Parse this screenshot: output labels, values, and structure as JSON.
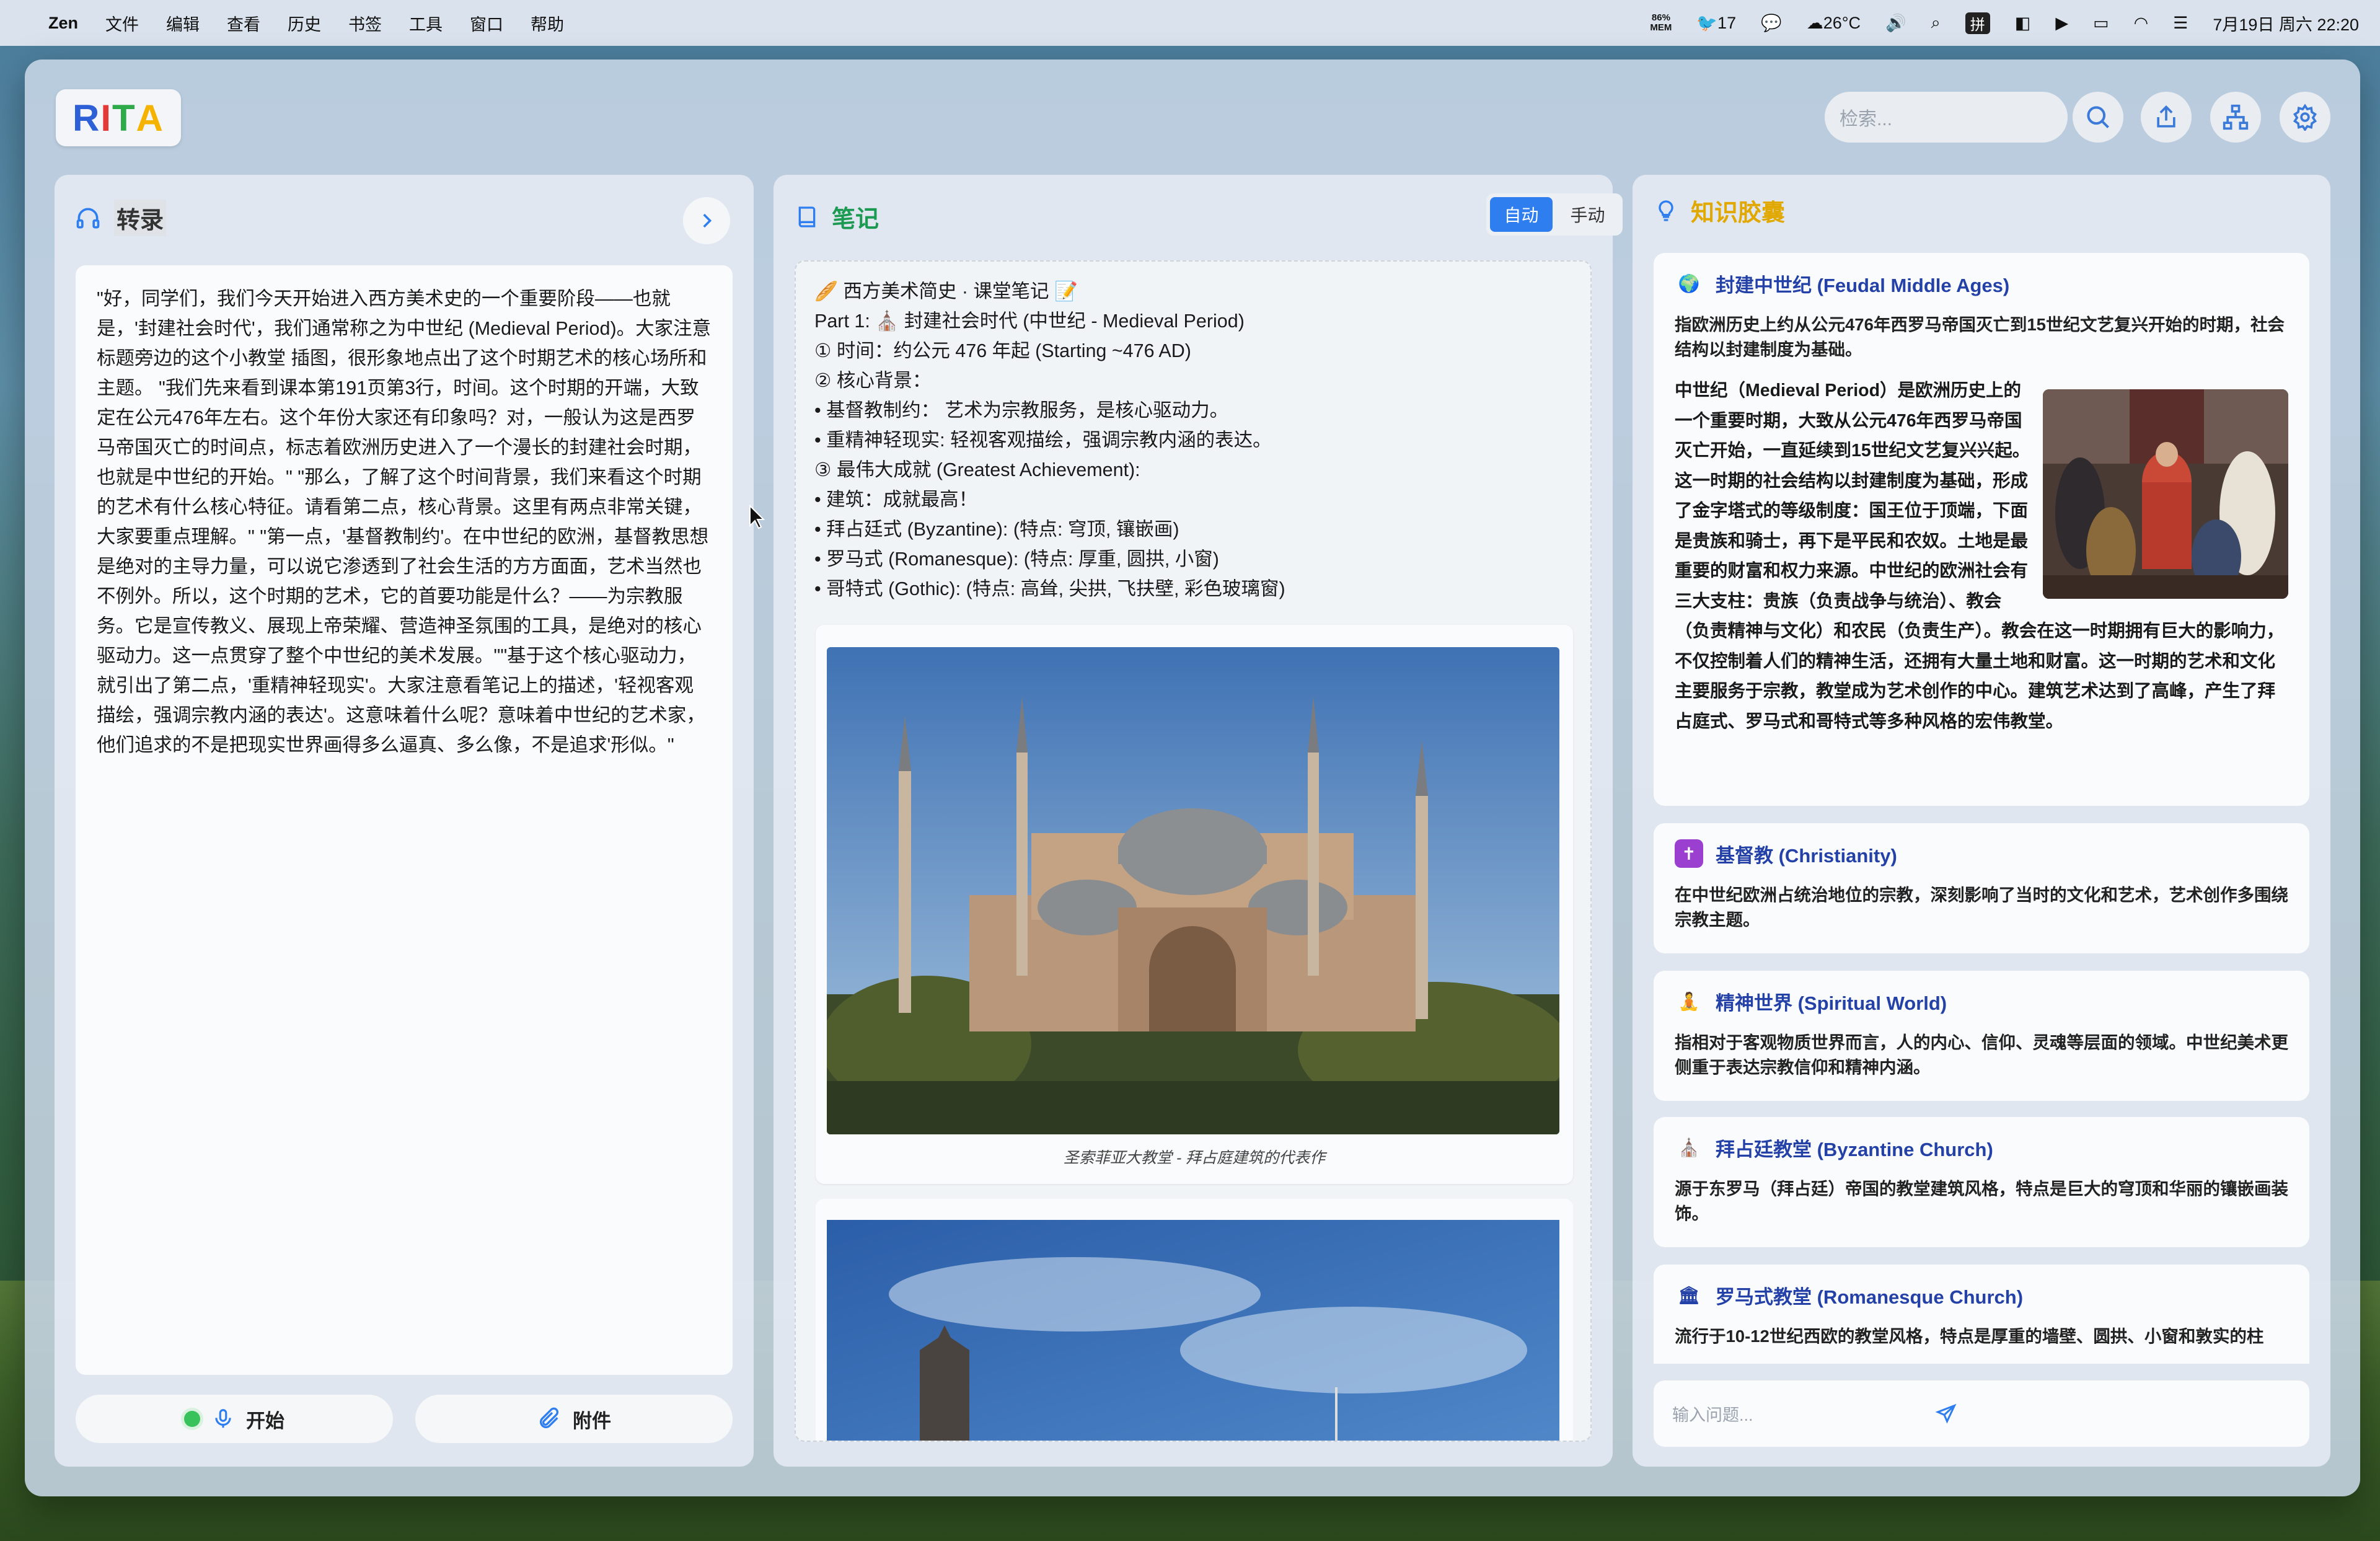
{
  "menubar": {
    "app": "Zen",
    "items": [
      "文件",
      "编辑",
      "查看",
      "历史",
      "书签",
      "工具",
      "窗口",
      "帮助"
    ],
    "mem_pct": "86%",
    "mem_label": "MEM",
    "notif_count": "17",
    "weather": "26°C",
    "input_method": "拼",
    "datetime": "7月19日 周六 22:20"
  },
  "brand": {
    "logo": "RITA"
  },
  "search": {
    "placeholder": "检索..."
  },
  "transcript": {
    "title": "转录",
    "text": "\"好，同学们，我们今天开始进入西方美术史的一个重要阶段——也就是，'封建社会时代'，我们通常称之为中世纪 (Medieval Period)。大家注意标题旁边的这个小教堂 插图，很形象地点出了这个时期艺术的核心场所和主题。 \"我们先来看到课本第191页第3行，时间。这个时期的开端，大致定在公元476年左右。这个年份大家还有印象吗？对，一般认为这是西罗马帝国灭亡的时间点，标志着欧洲历史进入了一个漫长的封建社会时期，也就是中世纪的开始。\" \"那么，了解了这个时间背景，我们来看这个时期的艺术有什么核心特征。请看第二点，核心背景。这里有两点非常关键，大家要重点理解。\" \"第一点，'基督教制约'。在中世纪的欧洲，基督教思想是绝对的主导力量，可以说它渗透到了社会生活的方方面面，艺术当然也不例外。所以，这个时期的艺术，它的首要功能是什么？——为宗教服务。它是宣传教义、展现上帝荣耀、营造神圣氛围的工具，是绝对的核心驱动力。这一点贯穿了整个中世纪的美术发展。\"\"基于这个核心驱动力，就引出了第二点，'重精神轻现实'。大家注意看笔记上的描述，'轻视客观描绘，强调宗教内涵的表达'。这意味着什么呢？意味着中世纪的艺术家，他们追求的不是把现实世界画得多么逼真、多么像，不是追求'形似。\"",
    "start_label": "开始",
    "attach_label": "附件"
  },
  "notes": {
    "title": "笔记",
    "mode_auto": "自动",
    "mode_manual": "手动",
    "lines": [
      "🥖 西方美术简史 · 课堂笔记 📝",
      "Part 1: ⛪ 封建社会时代 (中世纪 - Medieval Period)",
      "① 时间：约公元 476 年起 (Starting ~476 AD)",
      "② 核心背景：",
      "• 基督教制约：  艺术为宗教服务，是核心驱动力。",
      "• 重精神轻现实: 轻视客观描绘，强调宗教内涵的表达。",
      "③ 最伟大成就 (Greatest Achievement):",
      "• 建筑：成就最高！",
      "• 拜占廷式 (Byzantine): (特点: 穹顶, 镶嵌画)",
      "• 罗马式 (Romanesque): (特点: 厚重, 圆拱, 小窗)",
      "• 哥特式 (Gothic): (特点: 高耸, 尖拱, 飞扶壁, 彩色玻璃窗)"
    ],
    "image1_caption": "圣索菲亚大教堂 - 拜占庭建筑的代表作"
  },
  "knowledge": {
    "title": "知识胶囊",
    "cards": [
      {
        "icon": "🌍",
        "title": "封建中世纪 (Feudal Middle Ages)",
        "summary": "指欧洲历史上约从公元476年西罗马帝国灭亡到15世纪文艺复兴开始的时期，社会结构以封建制度为基础。",
        "body_intro": "中世纪（Medieval Period）是欧洲历史上的一个重要时期，大致从公元476年西罗马帝国灭亡开始，一直延续到15世纪文艺复兴兴起。这一时期的社会结构以封建制度为基础，形成了金字塔式的等级制度：国王位于顶端，下面是贵族和骑士，再下是平民和农奴。土地是最重要的财富和权力来源。中世纪的欧洲社会有三大支柱：贵族（负责战争与统治）、教会（负责精神与文化）和农民（负责生产）。教会在这一时期拥有巨大的影响力，不仅控制着人们的精神生活，",
        "body_tail": "还拥有大量土地和财富。这一时期的艺术和文化主要服务于宗教，教堂成为艺术创作的中心。建筑艺术达到了高峰，产生了拜占庭式、罗马式和哥特式等多种风格的宏伟教堂。"
      },
      {
        "icon": "✝️",
        "title": "基督教 (Christianity)",
        "summary": "在中世纪欧洲占统治地位的宗教，深刻影响了当时的文化和艺术，艺术创作多围绕宗教主题。"
      },
      {
        "icon": "🧘",
        "title": "精神世界 (Spiritual World)",
        "summary": "指相对于客观物质世界而言，人的内心、信仰、灵魂等层面的领域。中世纪美术更侧重于表达宗教信仰和精神内涵。"
      },
      {
        "icon": "⛪",
        "title": "拜占廷教堂 (Byzantine Church)",
        "summary": "源于东罗马（拜占廷）帝国的教堂建筑风格，特点是巨大的穹顶和华丽的镶嵌画装饰。"
      },
      {
        "icon": "🏛️",
        "title": "罗马式教堂 (Romanesque Church)",
        "summary": "流行于10-12世纪西欧的教堂风格，特点是厚重的墙壁、圆拱、小窗和敦实的柱"
      }
    ],
    "ask_placeholder": "输入问题..."
  },
  "colors": {
    "accent_blue": "#2f7ef0",
    "notes_green": "#1d9a52",
    "knowledge_amber": "#e0a800",
    "link_blue": "#2341a6"
  }
}
